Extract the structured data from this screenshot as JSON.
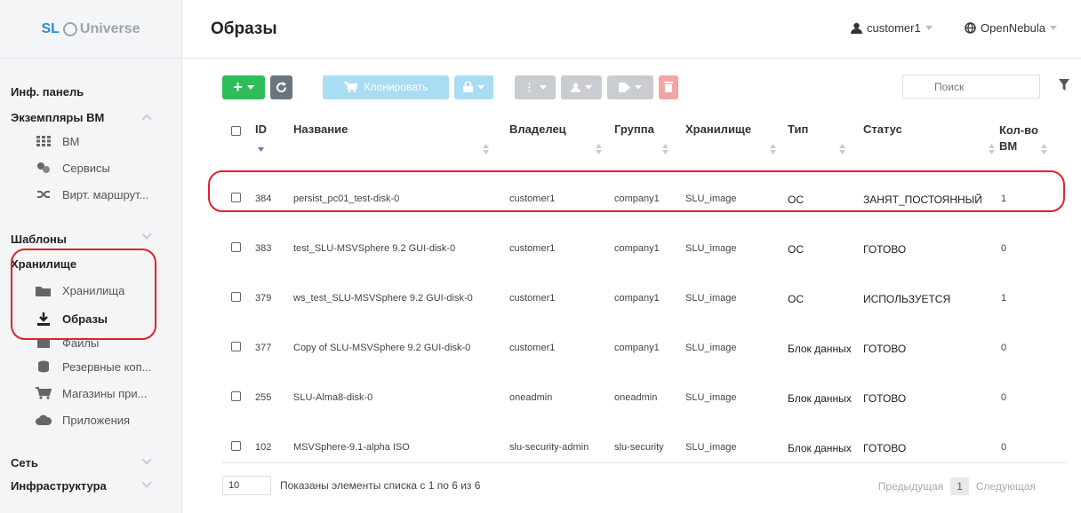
{
  "app": {
    "logo_prefix": "SL",
    "logo_name": "Universe"
  },
  "topbar": {
    "title": "Образы",
    "user": "customer1",
    "zone": "OpenNebula"
  },
  "sidebar": {
    "items": [
      {
        "label": "Инф. панель"
      },
      {
        "label": "Экземпляры ВМ"
      },
      {
        "label": "ВМ"
      },
      {
        "label": "Сервисы"
      },
      {
        "label": "Вирт. маршрут..."
      },
      {
        "label": "Шаблоны"
      },
      {
        "label": "Хранилище"
      },
      {
        "label": "Хранилища"
      },
      {
        "label": "Образы"
      },
      {
        "label": "Файлы"
      },
      {
        "label": "Резервные коп..."
      },
      {
        "label": "Магазины при..."
      },
      {
        "label": "Приложения"
      },
      {
        "label": "Сеть"
      },
      {
        "label": "Инфраструктура"
      }
    ]
  },
  "toolbar": {
    "clone_label": "Клонировать",
    "search_placeholder": "Поиск"
  },
  "table": {
    "headers": {
      "id": "ID",
      "name": "Название",
      "owner": "Владелец",
      "group": "Группа",
      "datastore": "Хранилище",
      "type": "Тип",
      "status": "Статус",
      "vms": "Кол-во ВМ"
    },
    "rows": [
      {
        "id": "384",
        "name": "persist_pc01_test-disk-0",
        "owner": "customer1",
        "group": "company1",
        "datastore": "SLU_image",
        "type": "ОС",
        "status": "ЗАНЯТ_ПОСТОЯННЫЙ",
        "vms": "1"
      },
      {
        "id": "383",
        "name": "test_SLU-MSVSphere 9.2 GUI-disk-0",
        "owner": "customer1",
        "group": "company1",
        "datastore": "SLU_image",
        "type": "ОС",
        "status": "ГОТОВО",
        "vms": "0"
      },
      {
        "id": "379",
        "name": "ws_test_SLU-MSVSphere 9.2 GUI-disk-0",
        "owner": "customer1",
        "group": "company1",
        "datastore": "SLU_image",
        "type": "ОС",
        "status": "ИСПОЛЬЗУЕТСЯ",
        "vms": "1"
      },
      {
        "id": "377",
        "name": "Copy of SLU-MSVSphere 9.2 GUI-disk-0",
        "owner": "customer1",
        "group": "company1",
        "datastore": "SLU_image",
        "type": "Блок данных",
        "status": "ГОТОВО",
        "vms": "0"
      },
      {
        "id": "255",
        "name": "SLU-Alma8-disk-0",
        "owner": "oneadmin",
        "group": "oneadmin",
        "datastore": "SLU_image",
        "type": "Блок данных",
        "status": "ГОТОВО",
        "vms": "0"
      },
      {
        "id": "102",
        "name": "MSVSphere-9.1-alpha ISO",
        "owner": "slu-security-admin",
        "group": "slu-security",
        "datastore": "SLU_image",
        "type": "Блок данных",
        "status": "ГОТОВО",
        "vms": "0"
      }
    ]
  },
  "footer": {
    "page_size": "10",
    "info": "Показаны элементы списка с 1 по 6 из 6",
    "prev": "Предыдущая",
    "page": "1",
    "next": "Следующая"
  },
  "colors": {
    "accent": "#2a8bd6",
    "green": "#2ebd59",
    "highlight": "#e0212b"
  }
}
